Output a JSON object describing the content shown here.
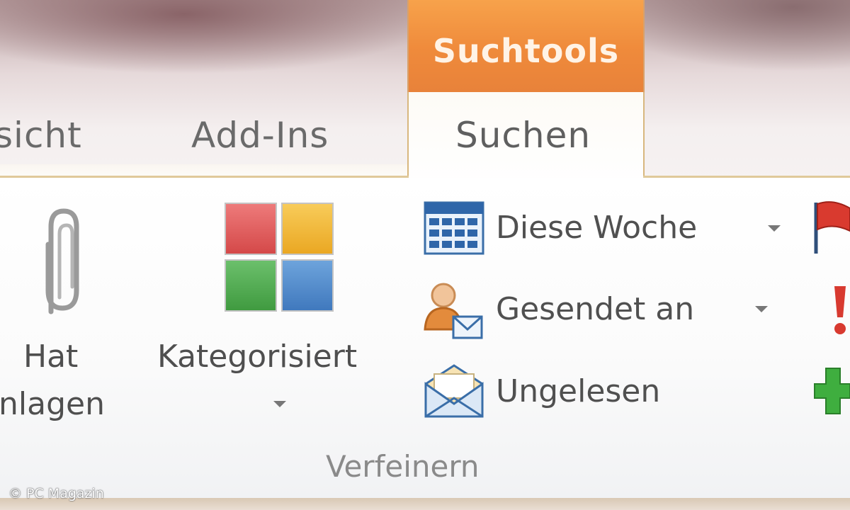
{
  "tabs": {
    "ansicht": "sicht",
    "addins": "Add-Ins",
    "contextual_group": "Suchtools",
    "active": "Suchen"
  },
  "ribbon": {
    "hat_anlagen": {
      "line1": "Hat",
      "line2": "nlagen",
      "icon": "paperclip-icon"
    },
    "kategorisiert": {
      "label": "Kategorisiert",
      "icon": "categories-icon"
    },
    "diese_woche": {
      "label": "Diese Woche",
      "icon": "calendar-icon"
    },
    "gesendet_an": {
      "label": "Gesendet an",
      "icon": "sent-to-person-icon"
    },
    "ungelesen": {
      "label": "Ungelesen",
      "icon": "envelope-icon"
    },
    "right_icons": [
      "flag-icon",
      "exclamation-icon",
      "plus-icon"
    ],
    "group_label": "Verfeinern"
  },
  "watermark": "© PC Magazin",
  "colors": {
    "contextual_orange": "#ef8a3b",
    "category_red": "#e05a5a",
    "category_yellow": "#f2b632",
    "category_green": "#4aa84a",
    "category_blue": "#4a86c8"
  }
}
